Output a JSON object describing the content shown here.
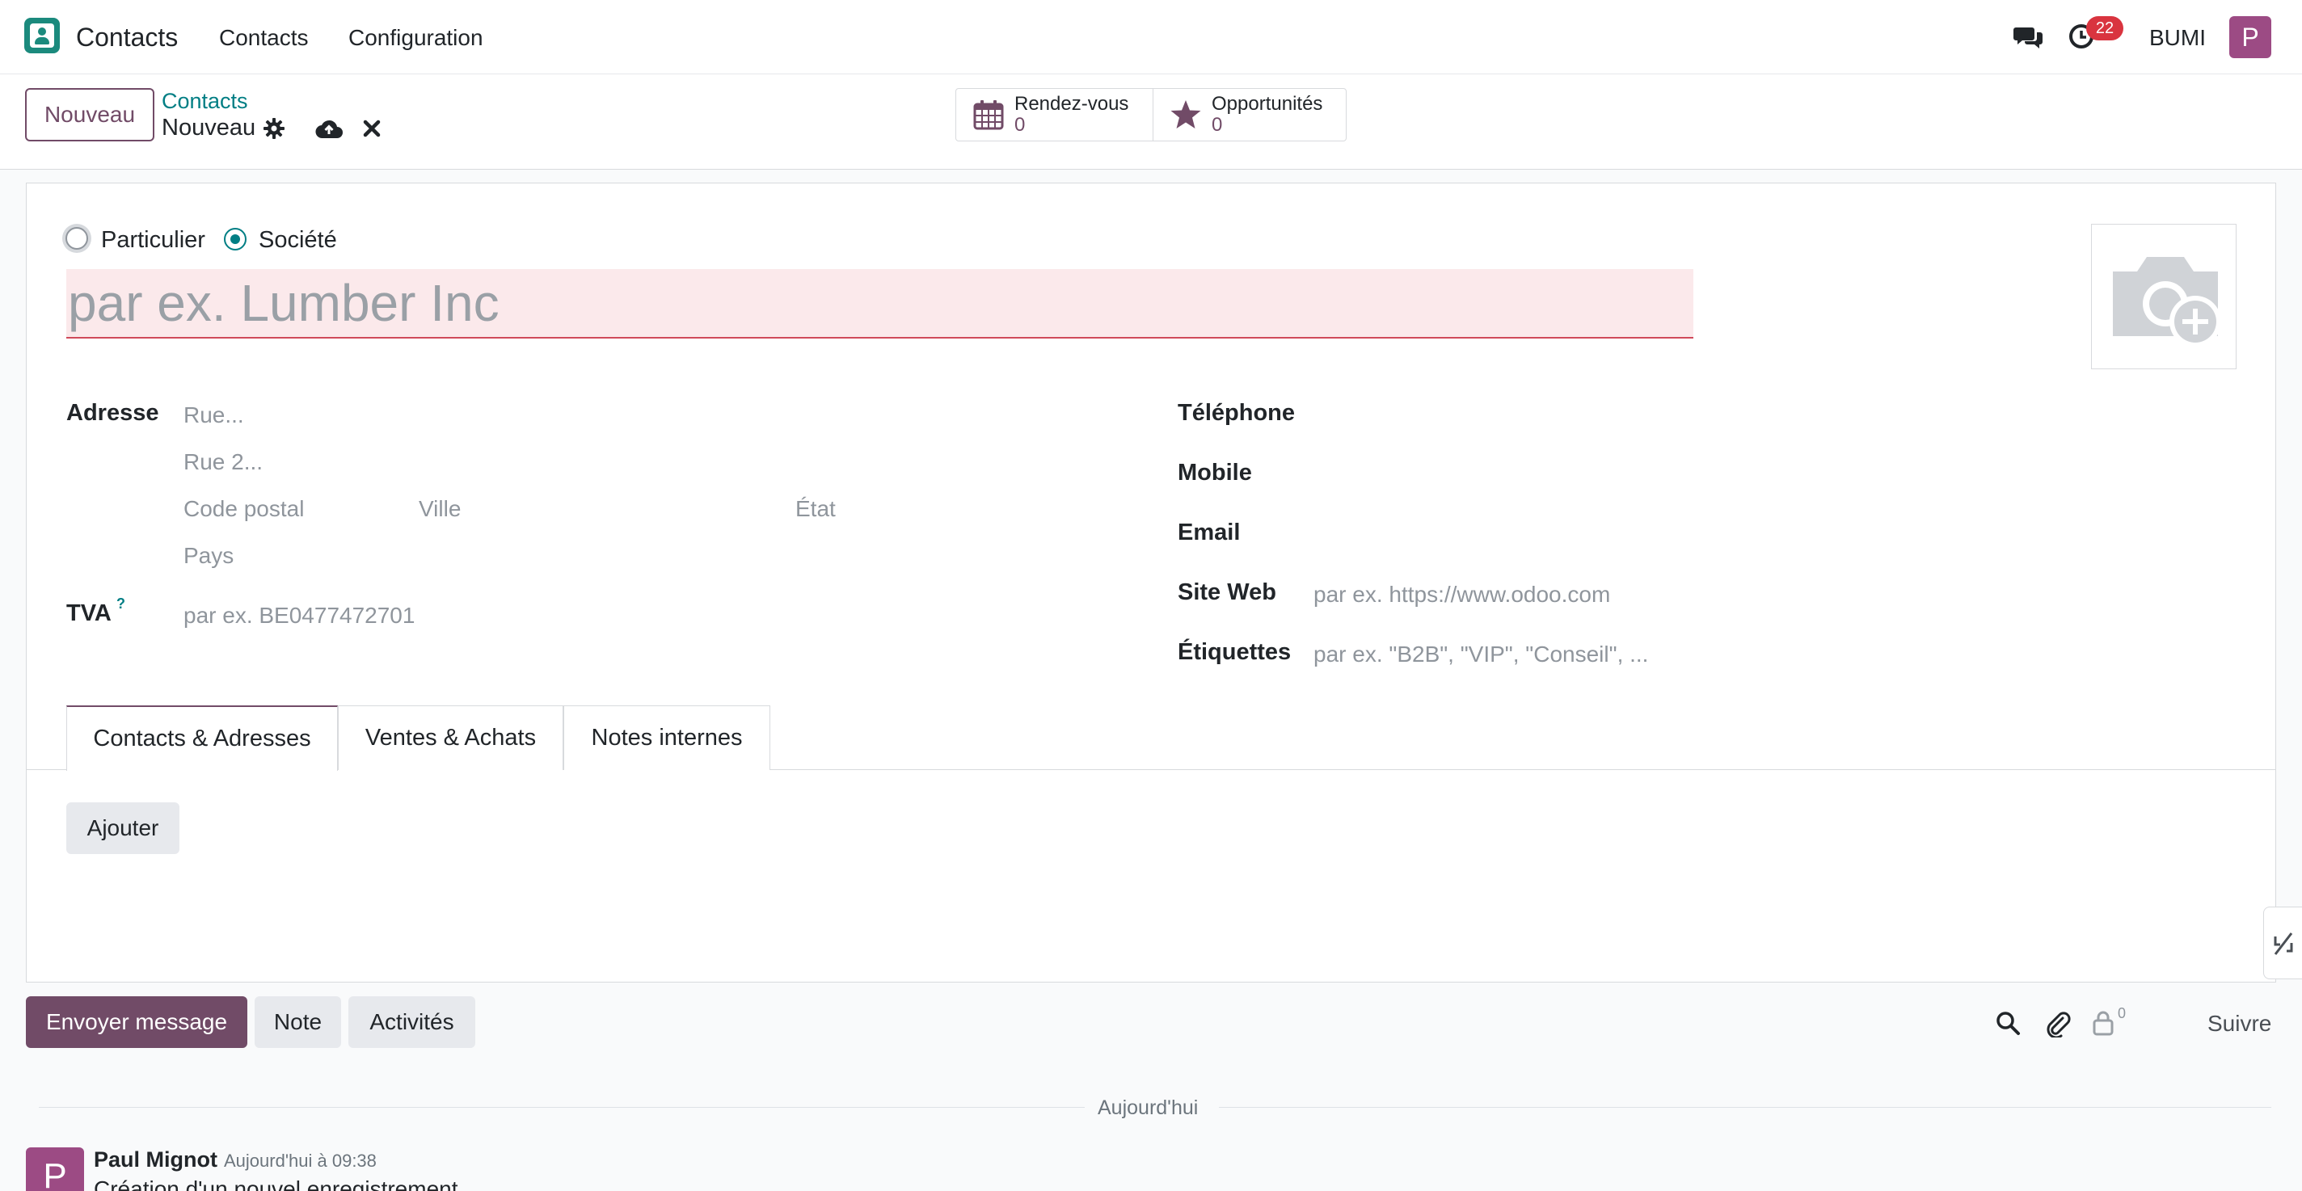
{
  "navbar": {
    "app_name": "Contacts",
    "menu": [
      "Contacts",
      "Configuration"
    ],
    "activity_count": "22",
    "company": "BUMI",
    "user_initial": "P"
  },
  "control": {
    "new_button": "Nouveau",
    "breadcrumb_parent": "Contacts",
    "breadcrumb_current": "Nouveau",
    "smart_buttons": [
      {
        "label": "Rendez-vous",
        "value": "0",
        "icon": "calendar-icon"
      },
      {
        "label": "Opportunités",
        "value": "0",
        "icon": "star-icon"
      }
    ]
  },
  "form": {
    "type_options": [
      {
        "label": "Particulier",
        "selected": false
      },
      {
        "label": "Société",
        "selected": true
      }
    ],
    "name_placeholder": "par ex. Lumber Inc",
    "address": {
      "label": "Adresse",
      "street": "Rue...",
      "street2": "Rue 2...",
      "zip": "Code postal",
      "city": "Ville",
      "state": "État",
      "country": "Pays"
    },
    "vat": {
      "label": "TVA",
      "help": "?",
      "placeholder": "par ex. BE0477472701"
    },
    "phone_label": "Téléphone",
    "mobile_label": "Mobile",
    "email_label": "Email",
    "website": {
      "label": "Site Web",
      "placeholder": "par ex. https://www.odoo.com"
    },
    "tags": {
      "label": "Étiquettes",
      "placeholder": "par ex. \"B2B\", \"VIP\", \"Conseil\", ..."
    },
    "tabs": [
      "Contacts & Adresses",
      "Ventes & Achats",
      "Notes internes"
    ],
    "add_button": "Ajouter"
  },
  "chatter": {
    "send_message": "Envoyer message",
    "note": "Note",
    "activities": "Activités",
    "followers_count": "0",
    "follow": "Suivre",
    "date_separator": "Aujourd'hui",
    "message": {
      "author": "Paul Mignot",
      "author_initial": "P",
      "date": "Aujourd'hui à 09:38",
      "body": "Création d'un nouvel enregistrement"
    }
  },
  "colors": {
    "brand": "#714b67",
    "accent": "#017e84",
    "badge": "#d9343f",
    "invalid_bg": "#fbe9eb"
  }
}
